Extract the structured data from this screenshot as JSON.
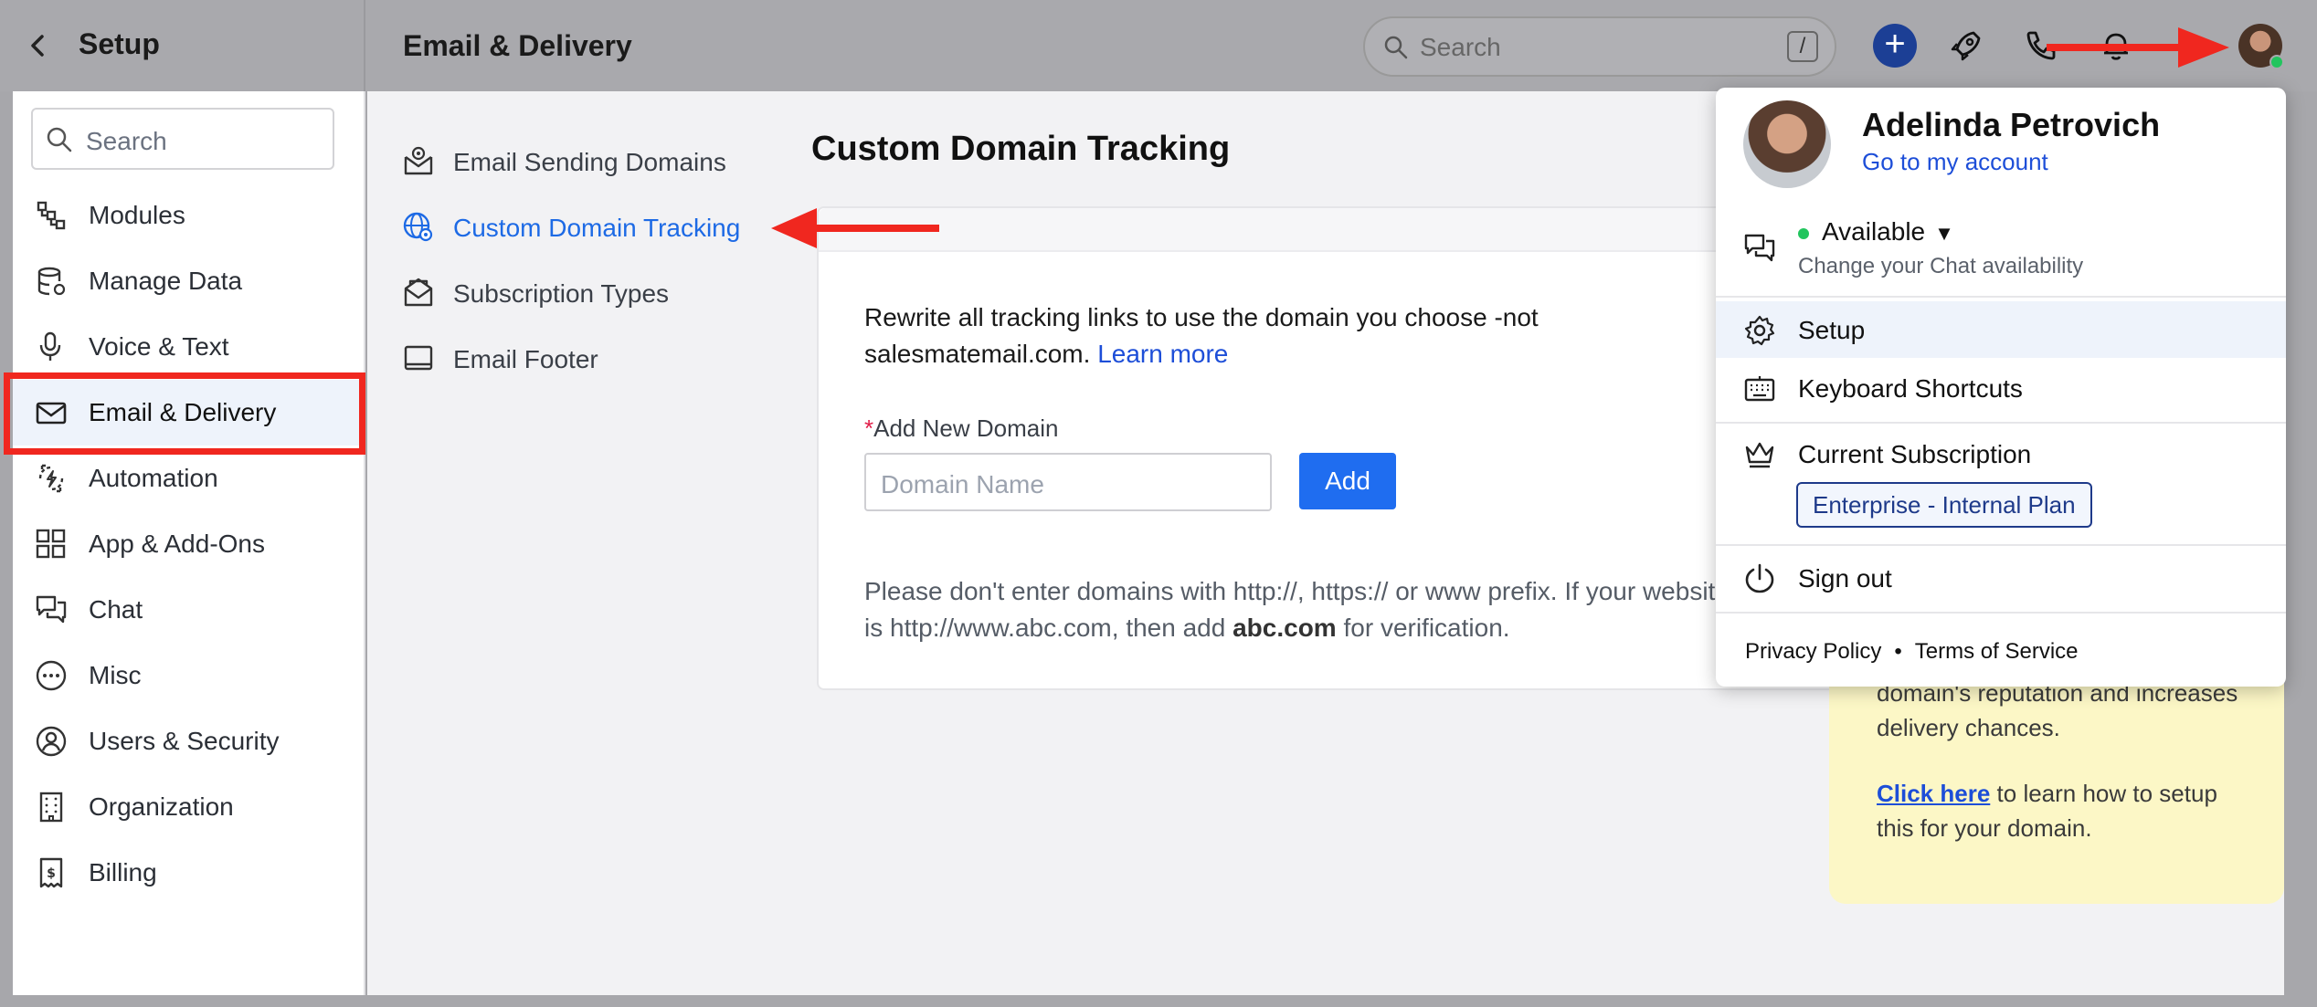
{
  "header": {
    "setup_title": "Setup",
    "page_title": "Email & Delivery",
    "search_placeholder": "Search",
    "search_shortcut": "/",
    "plus_label": "+"
  },
  "sidebar": {
    "search_placeholder": "Search",
    "items": [
      {
        "label": "Modules",
        "icon": "modules-icon"
      },
      {
        "label": "Manage Data",
        "icon": "database-icon"
      },
      {
        "label": "Voice & Text",
        "icon": "microphone-icon"
      },
      {
        "label": "Email & Delivery",
        "icon": "mail-icon",
        "active": true
      },
      {
        "label": "Automation",
        "icon": "automation-icon"
      },
      {
        "label": "App & Add-Ons",
        "icon": "apps-grid-icon"
      },
      {
        "label": "Chat",
        "icon": "chat-icon"
      },
      {
        "label": "Misc",
        "icon": "more-circle-icon"
      },
      {
        "label": "Users & Security",
        "icon": "user-circle-icon"
      },
      {
        "label": "Organization",
        "icon": "building-icon"
      },
      {
        "label": "Billing",
        "icon": "receipt-icon"
      }
    ]
  },
  "subnav": {
    "items": [
      {
        "label": "Email Sending Domains",
        "icon": "mail-at-icon"
      },
      {
        "label": "Custom Domain Tracking",
        "icon": "globe-icon",
        "active": true
      },
      {
        "label": "Subscription Types",
        "icon": "mail-open-icon"
      },
      {
        "label": "Email Footer",
        "icon": "footer-icon"
      }
    ]
  },
  "content": {
    "title": "Custom Domain Tracking",
    "description": "Rewrite all tracking links to use the domain you choose -not salesmatemail.com.",
    "learn_more": "Learn more",
    "field_label": "Add New Domain",
    "required_mark": "*",
    "field_placeholder": "Domain Name",
    "add_button": "Add",
    "note_part1": "Please don't enter domains with http://, https:// or www prefix. If your website is http://www.abc.com, then add",
    "note_bold": "abc.com",
    "note_part2": "for verification."
  },
  "info_box": {
    "text1": "domain's reputation and increases delivery chances.",
    "link": "Click here",
    "text2": "to learn how to setup this for your domain."
  },
  "dropdown": {
    "user_name": "Adelinda Petrovich",
    "account_link": "Go to my account",
    "status": "Available",
    "status_sub": "Change your Chat availability",
    "setup": "Setup",
    "keyboard_shortcuts": "Keyboard Shortcuts",
    "current_subscription": "Current Subscription",
    "plan": "Enterprise - Internal Plan",
    "sign_out": "Sign out",
    "privacy": "Privacy Policy",
    "bullet": "•",
    "terms": "Terms of Service"
  },
  "colors": {
    "accent": "#1f6df0",
    "annotation_red": "#f0271f",
    "available_green": "#22c55e",
    "info_yellow": "#fcf7c6"
  }
}
